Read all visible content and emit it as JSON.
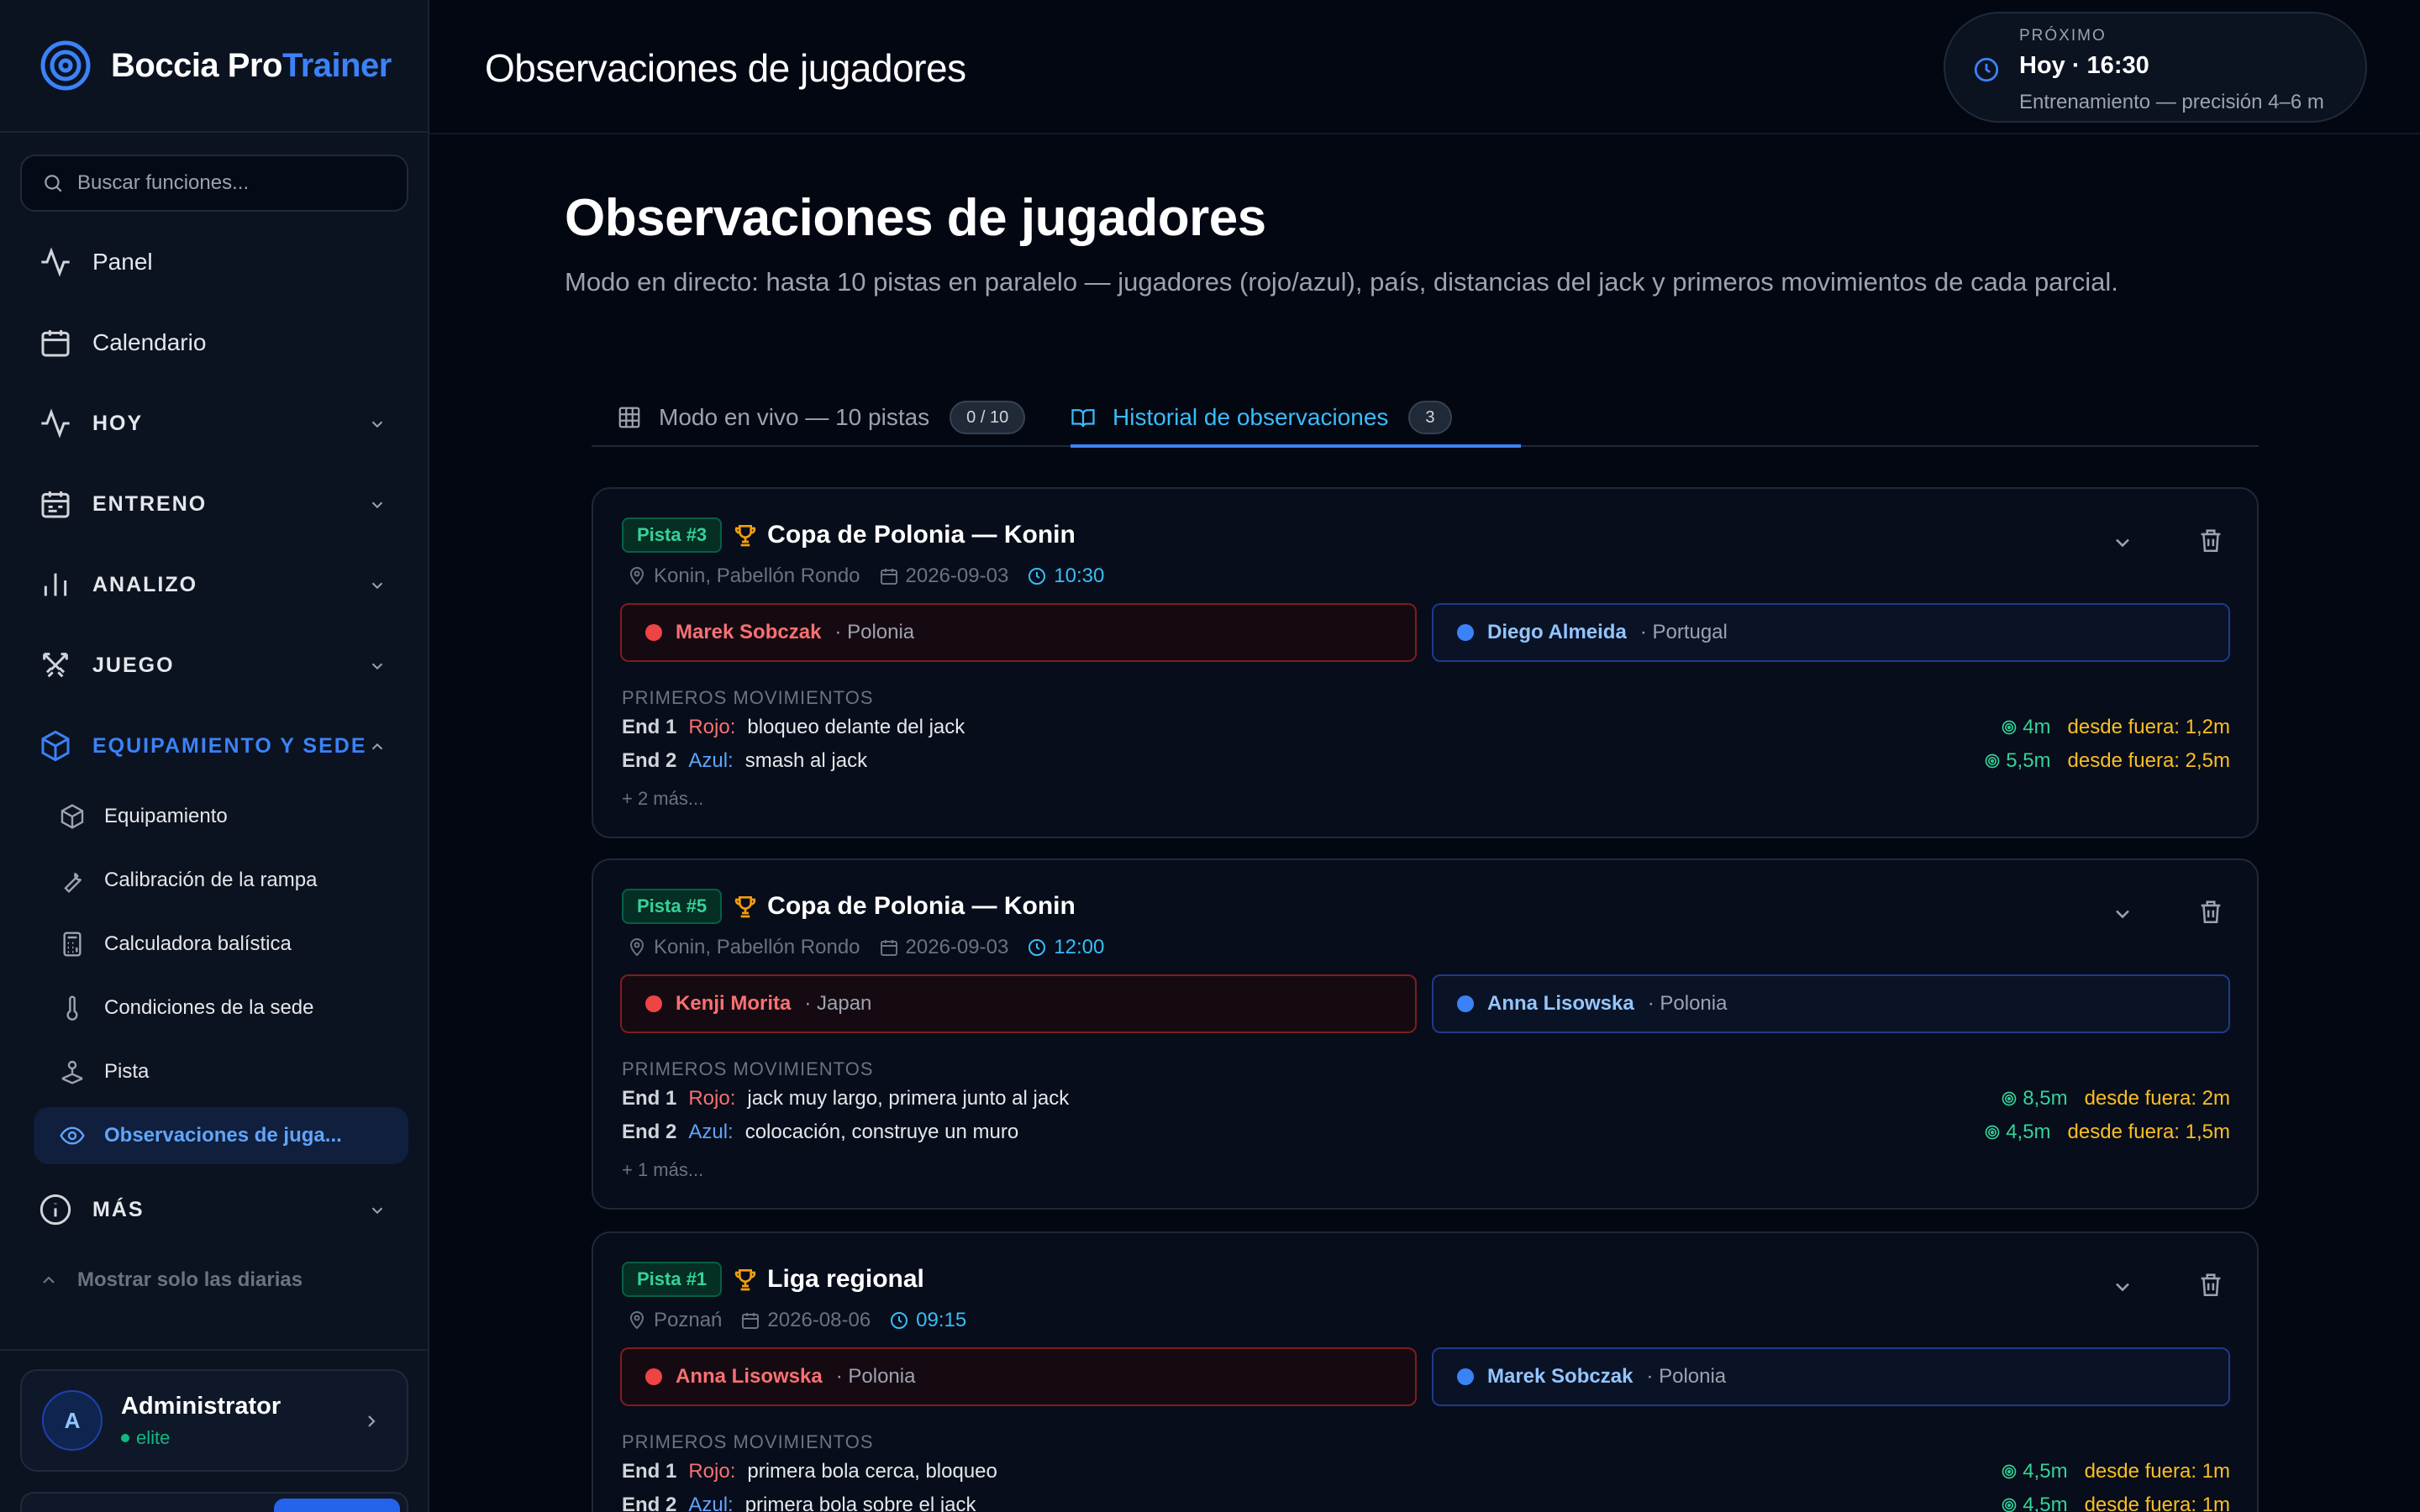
{
  "brand": {
    "name_main": "Boccia Pro",
    "name_accent": "Trainer"
  },
  "search": {
    "placeholder": "Buscar funciones..."
  },
  "nav": {
    "panel": "Panel",
    "calendar": "Calendario",
    "today": "HOY",
    "training": "ENTRENO",
    "analysis": "ANALIZO",
    "game": "JUEGO",
    "equipment_section": "EQUIPAMIENTO Y SEDE",
    "sub": {
      "equipment": "Equipamiento",
      "ramp": "Calibración de la rampa",
      "ballistic": "Calculadora balística",
      "venue": "Condiciones de la sede",
      "court": "Pista",
      "observations": "Observaciones de juga..."
    },
    "more": "MÁS",
    "show_daily": "Mostrar solo las diarias"
  },
  "user": {
    "initial": "A",
    "name": "Administrator",
    "tier": "elite"
  },
  "topbar": {
    "title": "Observaciones de jugadores",
    "next_label": "PRÓXIMO",
    "next_when": "Hoy · 16:30",
    "next_desc": "Entrenamiento — precisión 4–6 m"
  },
  "page": {
    "title": "Observaciones de jugadores",
    "subtitle": "Modo en directo: hasta 10 pistas en paralelo — jugadores (rojo/azul), país, distancias del jack y primeros movimientos de cada parcial."
  },
  "tabs": {
    "live_label": "Modo en vivo — 10 pistas",
    "live_count": "0 / 10",
    "history_label": "Historial de observaciones",
    "history_count": "3"
  },
  "moves_title": "PRIMEROS MOVIMIENTOS",
  "cards": [
    {
      "court": "Pista #3",
      "event": "Copa de Polonia — Konin",
      "location": "Konin, Pabellón Rondo",
      "date": "2026-09-03",
      "time": "10:30",
      "red": {
        "name": "Marek Sobczak",
        "country": "· Polonia"
      },
      "blue": {
        "name": "Diego Almeida",
        "country": "· Portugal"
      },
      "moves": [
        {
          "end": "End 1",
          "side": "Rojo:",
          "desc": "bloqueo delante del jack",
          "target": "4m",
          "outside": "desde fuera: 1,2m"
        },
        {
          "end": "End 2",
          "side": "Azul:",
          "desc": "smash al jack",
          "target": "5,5m",
          "outside": "desde fuera: 2,5m"
        }
      ],
      "more": "+ 2 más..."
    },
    {
      "court": "Pista #5",
      "event": "Copa de Polonia — Konin",
      "location": "Konin, Pabellón Rondo",
      "date": "2026-09-03",
      "time": "12:00",
      "red": {
        "name": "Kenji Morita",
        "country": "· Japan"
      },
      "blue": {
        "name": "Anna Lisowska",
        "country": "· Polonia"
      },
      "moves": [
        {
          "end": "End 1",
          "side": "Rojo:",
          "desc": "jack muy largo, primera junto al jack",
          "target": "8,5m",
          "outside": "desde fuera: 2m"
        },
        {
          "end": "End 2",
          "side": "Azul:",
          "desc": "colocación, construye un muro",
          "target": "4,5m",
          "outside": "desde fuera: 1,5m"
        }
      ],
      "more": "+ 1 más..."
    },
    {
      "court": "Pista #1",
      "event": "Liga regional",
      "location": "Poznań",
      "date": "2026-08-06",
      "time": "09:15",
      "red": {
        "name": "Anna Lisowska",
        "country": "· Polonia"
      },
      "blue": {
        "name": "Marek Sobczak",
        "country": "· Polonia"
      },
      "moves": [
        {
          "end": "End 1",
          "side": "Rojo:",
          "desc": "primera bola cerca, bloqueo",
          "target": "4,5m",
          "outside": "desde fuera: 1m"
        },
        {
          "end": "End 2",
          "side": "Azul:",
          "desc": "primera bola sobre el jack",
          "target": "4,5m",
          "outside": "desde fuera: 1m"
        }
      ],
      "more": ""
    }
  ]
}
